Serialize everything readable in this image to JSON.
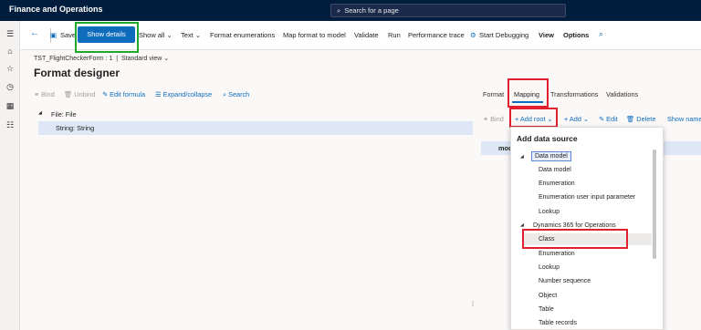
{
  "topbar": {
    "app_title": "Finance and Operations",
    "search_placeholder": "Search for a page"
  },
  "actionpane": {
    "save": "Save",
    "show_details": "Show details",
    "show_all": "Show all",
    "text": "Text",
    "format_enumerations": "Format enumerations",
    "map_format_to_model": "Map format to model",
    "validate": "Validate",
    "run": "Run",
    "performance_trace": "Performance trace",
    "start_debugging": "Start Debugging",
    "view": "View",
    "options": "Options"
  },
  "breadcrumb": {
    "form": "TST_FlightCheckerForm : 1",
    "separator": "|",
    "view": "Standard view"
  },
  "page_title": "Format designer",
  "format_toolbar": {
    "bind": "Bind",
    "unbind": "Unbind",
    "edit_formula": "Edit formula",
    "expand_collapse": "Expand/collapse",
    "search": "Search"
  },
  "format_tree": {
    "file": "File: File",
    "string": "String: String"
  },
  "tabs": {
    "format": "Format",
    "mapping": "Mapping",
    "transformations": "Transformations",
    "validations": "Validations"
  },
  "mapping_toolbar": {
    "bind": "Bind",
    "add_root": "Add root",
    "add": "Add",
    "edit": "Edit",
    "delete": "Delete",
    "show_name": "Show name"
  },
  "model_row": "mod",
  "add_data_source": {
    "title": "Add data source",
    "group_data_model": "Data model",
    "data_model_items": [
      "Data model",
      "Enumeration",
      "Enumeration user input parameter",
      "Lookup"
    ],
    "group_d365": "Dynamics 365 for Operations",
    "d365_items": [
      "Class",
      "Enumeration",
      "Lookup",
      "Number sequence",
      "Object",
      "Table",
      "Table records"
    ]
  },
  "colors": {
    "highlight_green": "#1ea82c",
    "highlight_red": "#e0202e",
    "primary": "#0f6cbd",
    "topbar": "#001d3d"
  }
}
